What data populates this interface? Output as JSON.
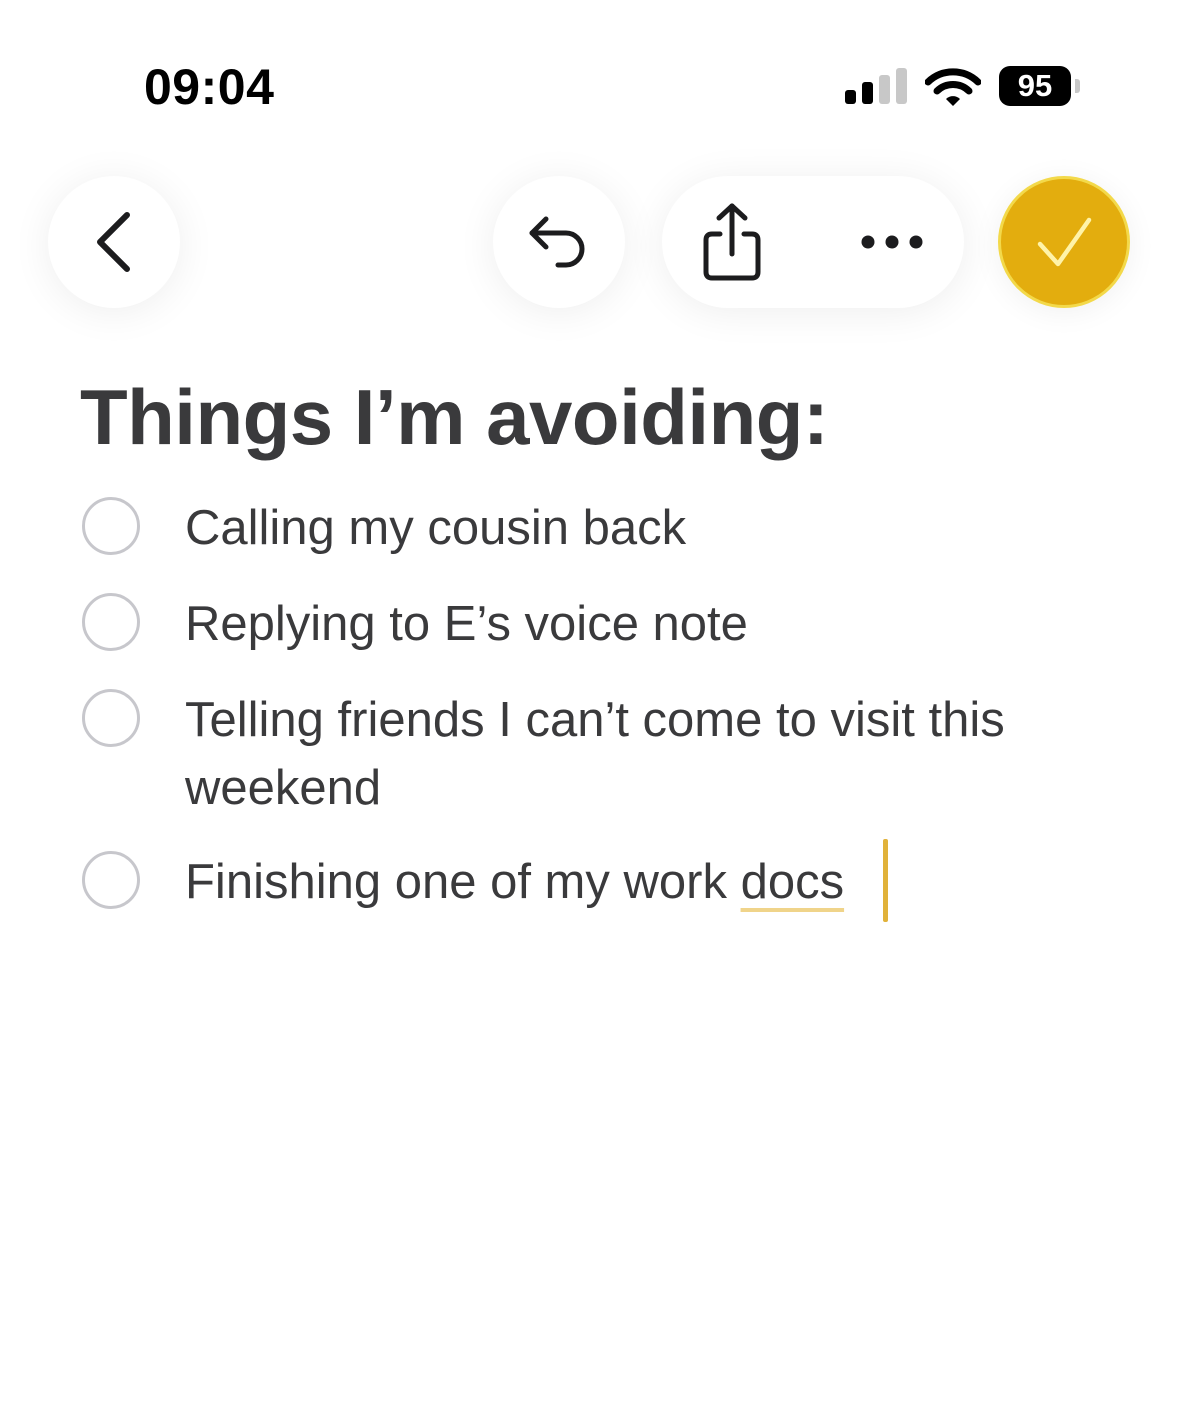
{
  "status_bar": {
    "time": "09:04",
    "battery": "95",
    "signal_icon": "cellular-signal-icon",
    "wifi_icon": "wifi-icon"
  },
  "toolbar": {
    "back_icon": "chevron-left-icon",
    "undo_icon": "undo-icon",
    "share_icon": "share-icon",
    "more_icon": "ellipsis-icon",
    "done_icon": "checkmark-icon",
    "accent_color": "#e3ad0e"
  },
  "note": {
    "title": "Things I’m avoiding:",
    "items": [
      {
        "text": "Calling my cousin back",
        "checked": false
      },
      {
        "text": "Replying to E’s voice note",
        "checked": false
      },
      {
        "text": "Telling friends I can’t come to visit this weekend",
        "checked": false
      },
      {
        "text_before": "Finishing one of my work ",
        "text_underlined": "docs",
        "checked": false
      }
    ]
  }
}
